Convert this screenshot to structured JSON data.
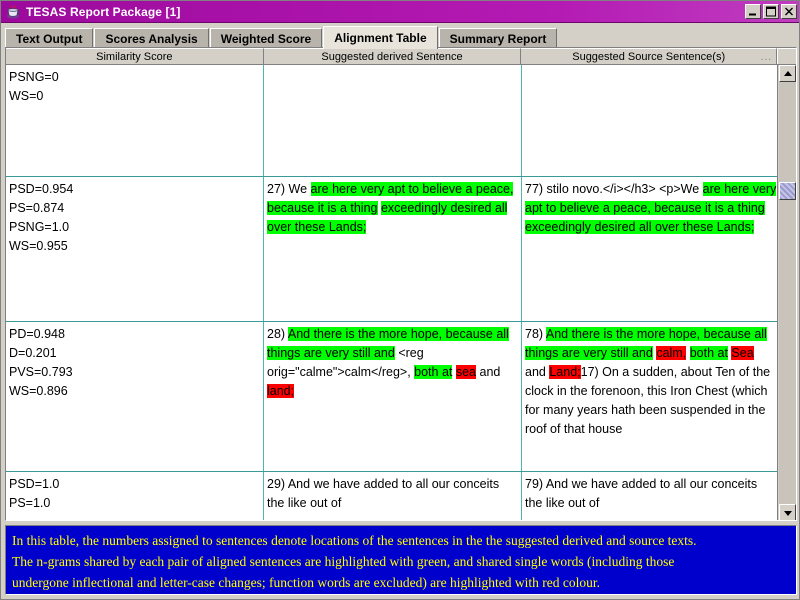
{
  "window": {
    "title": "TESAS Report Package [1]",
    "icon": "java-cup-icon",
    "controls": {
      "minimize": "minimize-button",
      "maximize": "maximize-button",
      "close": "close-button"
    }
  },
  "tabs": [
    {
      "label": "Text Output",
      "selected": false
    },
    {
      "label": "Scores Analysis",
      "selected": false
    },
    {
      "label": "Weighted Score",
      "selected": false
    },
    {
      "label": "Alignment Table",
      "selected": true
    },
    {
      "label": "Summary Report",
      "selected": false
    }
  ],
  "table": {
    "columns": [
      "Similarity Score",
      "Suggested derived Sentence",
      "Suggested Source Sentence(s)"
    ],
    "header_overflow": "...",
    "rows": [
      {
        "scores": [
          "PSNG=0",
          "WS=0"
        ],
        "derived": [],
        "source": []
      },
      {
        "scores": [
          "PSD=0.954",
          "PS=0.874",
          "PSNG=1.0",
          "WS=0.955"
        ],
        "derived": [
          {
            "text": "27) We ",
            "hl": "none"
          },
          {
            "text": "are here very apt to believe a peace, because it is a thing",
            "hl": "green"
          },
          {
            "text": " ",
            "hl": "none"
          },
          {
            "text": "exceedingly desired all over these Lands;",
            "hl": "green"
          }
        ],
        "source": [
          {
            "text": "77) stilo novo.</i></h3> <p>We ",
            "hl": "none"
          },
          {
            "text": "are here very apt to believe a peace, because it is a thing exceedingly desired all over these Lands;",
            "hl": "green"
          }
        ]
      },
      {
        "scores": [
          "PD=0.948",
          "D=0.201",
          "PVS=0.793",
          "WS=0.896"
        ],
        "derived": [
          {
            "text": "28) ",
            "hl": "none"
          },
          {
            "text": "And there is the more hope, because all things are very still and",
            "hl": "green"
          },
          {
            "text": " ",
            "hl": "none"
          },
          {
            "text": "<reg orig=\"calme\">calm</reg>, ",
            "hl": "none"
          },
          {
            "text": "both at",
            "hl": "green"
          },
          {
            "text": " ",
            "hl": "none"
          },
          {
            "text": "sea",
            "hl": "red"
          },
          {
            "text": " and ",
            "hl": "none"
          },
          {
            "text": "land;",
            "hl": "red"
          }
        ],
        "source": [
          {
            "text": "78) ",
            "hl": "none"
          },
          {
            "text": "And there is the more hope, because all things are very still and",
            "hl": "green"
          },
          {
            "text": " ",
            "hl": "none"
          },
          {
            "text": "calm,",
            "hl": "red"
          },
          {
            "text": " ",
            "hl": "none"
          },
          {
            "text": "both at",
            "hl": "green"
          },
          {
            "text": " ",
            "hl": "none"
          },
          {
            "text": "Sea",
            "hl": "red"
          },
          {
            "text": " and ",
            "hl": "none"
          },
          {
            "text": "Land;",
            "hl": "red"
          },
          {
            "text": "17) On a sudden, about Ten of the clock in the forenoon, this Iron Chest (which for many years hath been suspended in the roof of that house",
            "hl": "none"
          }
        ]
      },
      {
        "scores": [
          "PSD=1.0",
          "PS=1.0"
        ],
        "derived": [
          {
            "text": "29) And we have added to all our conceits the like out of",
            "hl": "none"
          }
        ],
        "source": [
          {
            "text": "79) And we have added to all our conceits the like out of",
            "hl": "none"
          }
        ]
      }
    ]
  },
  "scrollbar": {
    "up_arrow": "scroll-up-arrow",
    "down_arrow": "scroll-down-arrow",
    "thumb": "scroll-thumb"
  },
  "legend": {
    "lines": [
      "In this table, the numbers assigned to sentences denote locations of the sentences in the the suggested derived and source texts.",
      "The n-grams shared by each pair of aligned sentences are highlighted with green, and shared single words (including those",
      "undergone inflectional and letter-case changes; function words are excluded) are highlighted with red colour."
    ]
  },
  "colors": {
    "titlebar": "#a912a9",
    "highlight_green": "#00ff00",
    "highlight_red": "#ff0000",
    "legend_background": "#0000cc",
    "legend_text": "#ffff00",
    "grid_line": "#4fb3b3"
  }
}
